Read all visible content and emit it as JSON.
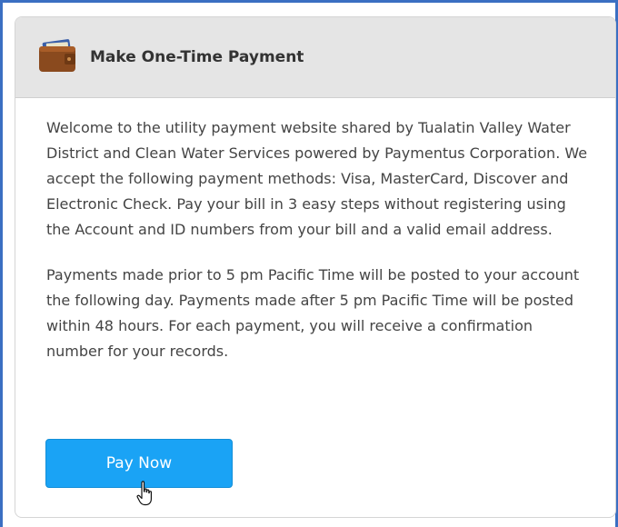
{
  "panel": {
    "title": "Make One-Time Payment",
    "icon": "wallet-icon",
    "paragraphs": [
      "Welcome to the utility payment website shared by Tualatin Valley Water District and Clean Water Services powered by Paymentus Corporation. We accept the following payment methods: Visa, MasterCard, Discover and Electronic Check. Pay your bill in 3 easy steps without registering using the Account and ID numbers from your bill and a valid email address.",
      "Payments made prior to 5 pm Pacific Time will be posted to your account the following day. Payments made after 5 pm Pacific Time will be posted within 48 hours. For each payment, you will receive a confirmation number for your records."
    ],
    "button_label": "Pay Now",
    "cursor": "hand-pointer-icon"
  },
  "colors": {
    "frame_border": "#3b6fc2",
    "header_bg": "#e5e5e5",
    "button_bg": "#1aa3f5",
    "text": "#444444"
  }
}
